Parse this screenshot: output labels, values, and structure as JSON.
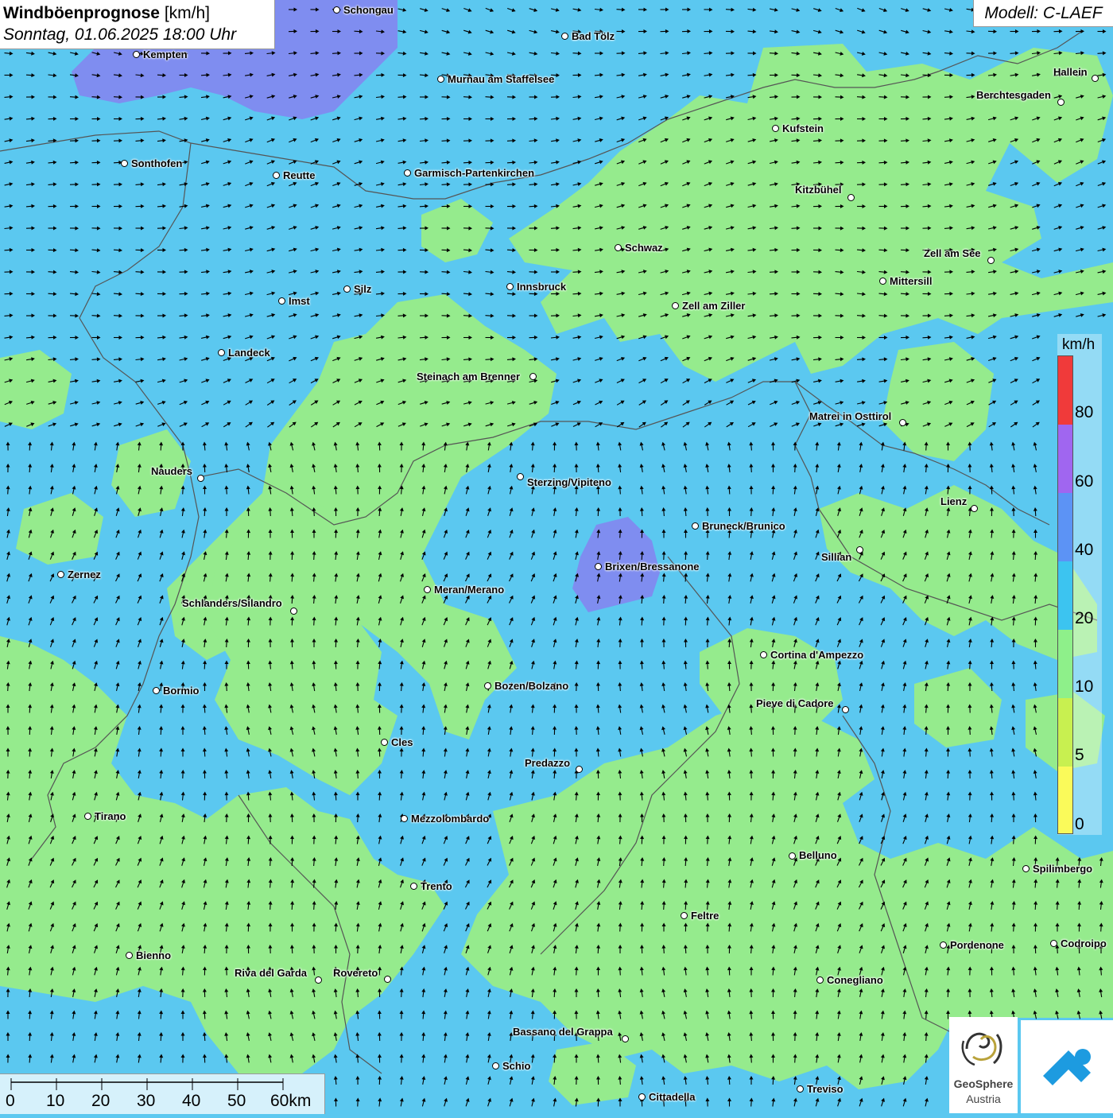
{
  "title": {
    "main": "Windböenprognose",
    "unit": "[km/h]",
    "datetime": "Sonntag, 01.06.2025 18:00 Uhr"
  },
  "model": "Modell: C-LAEF",
  "legend": {
    "unit": "km/h",
    "labels": [
      "80",
      "60",
      "40",
      "20",
      "10",
      "5",
      "0"
    ],
    "colors": [
      "#f03a3a",
      "#a066f0",
      "#5c93f5",
      "#3cc4f0",
      "#8ef08a",
      "#c8f050",
      "#fafa5a"
    ]
  },
  "scale": {
    "labels": [
      "0",
      "10",
      "20",
      "30",
      "40",
      "50",
      "60km"
    ]
  },
  "logos": {
    "geosphere_line1": "GeoSphere",
    "geosphere_line2": "Austria"
  },
  "colors": {
    "base_blue": "#5bc8f0",
    "green": "#95eb8d",
    "purple": "#7f8df0",
    "arrow": "#000000"
  },
  "cities": [
    {
      "name": "Schongau"
    },
    {
      "name": "Bad Tölz"
    },
    {
      "name": "Kempten"
    },
    {
      "name": "Murnau am Staffelsee"
    },
    {
      "name": "Hallein"
    },
    {
      "name": "Berchtesgaden"
    },
    {
      "name": "Kufstein"
    },
    {
      "name": "Sonthofen"
    },
    {
      "name": "Reutte"
    },
    {
      "name": "Garmisch-Partenkirchen"
    },
    {
      "name": "Kitzbühel"
    },
    {
      "name": "Schwaz"
    },
    {
      "name": "Zell am See"
    },
    {
      "name": "Mittersill"
    },
    {
      "name": "Innsbruck"
    },
    {
      "name": "Silz"
    },
    {
      "name": "Imst"
    },
    {
      "name": "Zell am Ziller"
    },
    {
      "name": "Landeck"
    },
    {
      "name": "Steinach am Brenner"
    },
    {
      "name": "Matrei in Osttirol"
    },
    {
      "name": "Nauders"
    },
    {
      "name": "Sterzing/Vipiteno"
    },
    {
      "name": "Lienz"
    },
    {
      "name": "Bruneck/Brunico"
    },
    {
      "name": "Sillian"
    },
    {
      "name": "Brixen/Bressanone"
    },
    {
      "name": "Zernez"
    },
    {
      "name": "Meran/Merano"
    },
    {
      "name": "Schlanders/Silandro"
    },
    {
      "name": "Cortina d'Ampezzo"
    },
    {
      "name": "Bozen/Bolzano"
    },
    {
      "name": "Bormio"
    },
    {
      "name": "Pieve di Cadore"
    },
    {
      "name": "Cles"
    },
    {
      "name": "Predazzo"
    },
    {
      "name": "Tirano"
    },
    {
      "name": "Mezzolombardo"
    },
    {
      "name": "Belluno"
    },
    {
      "name": "Spilimbergo"
    },
    {
      "name": "Trento"
    },
    {
      "name": "Feltre"
    },
    {
      "name": "Pordenone"
    },
    {
      "name": "Codroipo"
    },
    {
      "name": "Bienno"
    },
    {
      "name": "Riva del Garda"
    },
    {
      "name": "Rovereto"
    },
    {
      "name": "Conegliano"
    },
    {
      "name": "Bassano del Grappa"
    },
    {
      "name": "Schio"
    },
    {
      "name": "Treviso"
    },
    {
      "name": "Cittadella"
    }
  ]
}
